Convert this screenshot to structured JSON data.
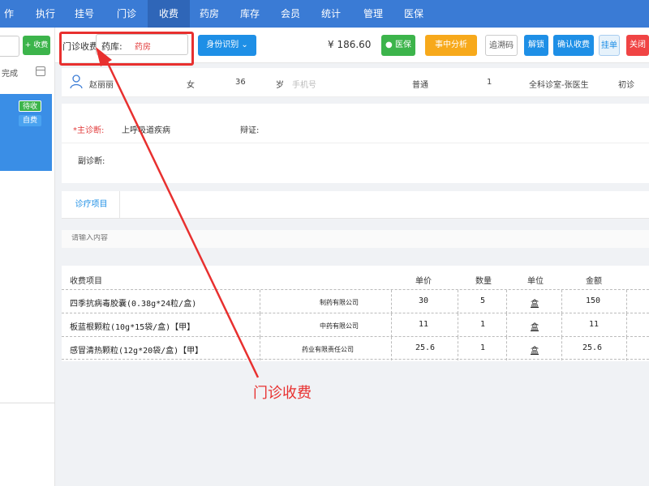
{
  "nav": {
    "items": [
      "作台",
      "执行",
      "挂号",
      "门诊",
      "收费",
      "药房",
      "库存",
      "会员",
      "统计",
      "管理",
      "医保"
    ],
    "active_index": 4
  },
  "left": {
    "button_label": "+ 收费",
    "done_label": "完成",
    "badge_wait": "待收",
    "badge_self": "自费"
  },
  "toolbar": {
    "clinic_label": "门诊收费",
    "store_label": "药库:",
    "store_value": "药房",
    "id_button": "身份识别",
    "price": "¥ 186.60",
    "medical_insurance": "医保",
    "analysis": "事中分析",
    "trace_code": "追溯码",
    "unlock": "解锁",
    "confirm": "确认收费",
    "hold": "挂单",
    "close": "关闭"
  },
  "patient": {
    "name": "赵丽丽",
    "gender": "女",
    "age": "36",
    "age_unit": "岁",
    "phone_placeholder": "手机号",
    "type": "普通",
    "count": "1",
    "dept": "全科诊室-张医生",
    "visit": "初诊"
  },
  "diagnosis": {
    "main_label": "*主诊断:",
    "main_value": "上呼吸道疾病",
    "syndrome_label": "辩证:",
    "secondary_label": "副诊断:"
  },
  "tabs": [
    "诊疗项目"
  ],
  "search": {
    "placeholder": "请输入内容"
  },
  "table": {
    "headers": [
      "收费项目",
      "单价",
      "数量",
      "单位",
      "金额"
    ],
    "rows": [
      {
        "item": "四季抗病毒胶囊(0.38g*24粒/盒)",
        "mfr": "制药有限公司",
        "price": "30",
        "qty": "5",
        "unit": "盒",
        "amount": "150"
      },
      {
        "item": "板蓝根颗粒(10g*15袋/盒)【甲】",
        "mfr": "中药有限公司",
        "price": "11",
        "qty": "1",
        "unit": "盒",
        "amount": "11"
      },
      {
        "item": "感冒清热颗粒(12g*20袋/盒)【甲】",
        "mfr": "药业有限责任公司",
        "price": "25.6",
        "qty": "1",
        "unit": "盒",
        "amount": "25.6"
      }
    ]
  },
  "annotation": "门诊收费",
  "colors": {
    "nav": "#3a7bd5",
    "accent": "#1e8fe6",
    "annotation": "#e8302f"
  }
}
